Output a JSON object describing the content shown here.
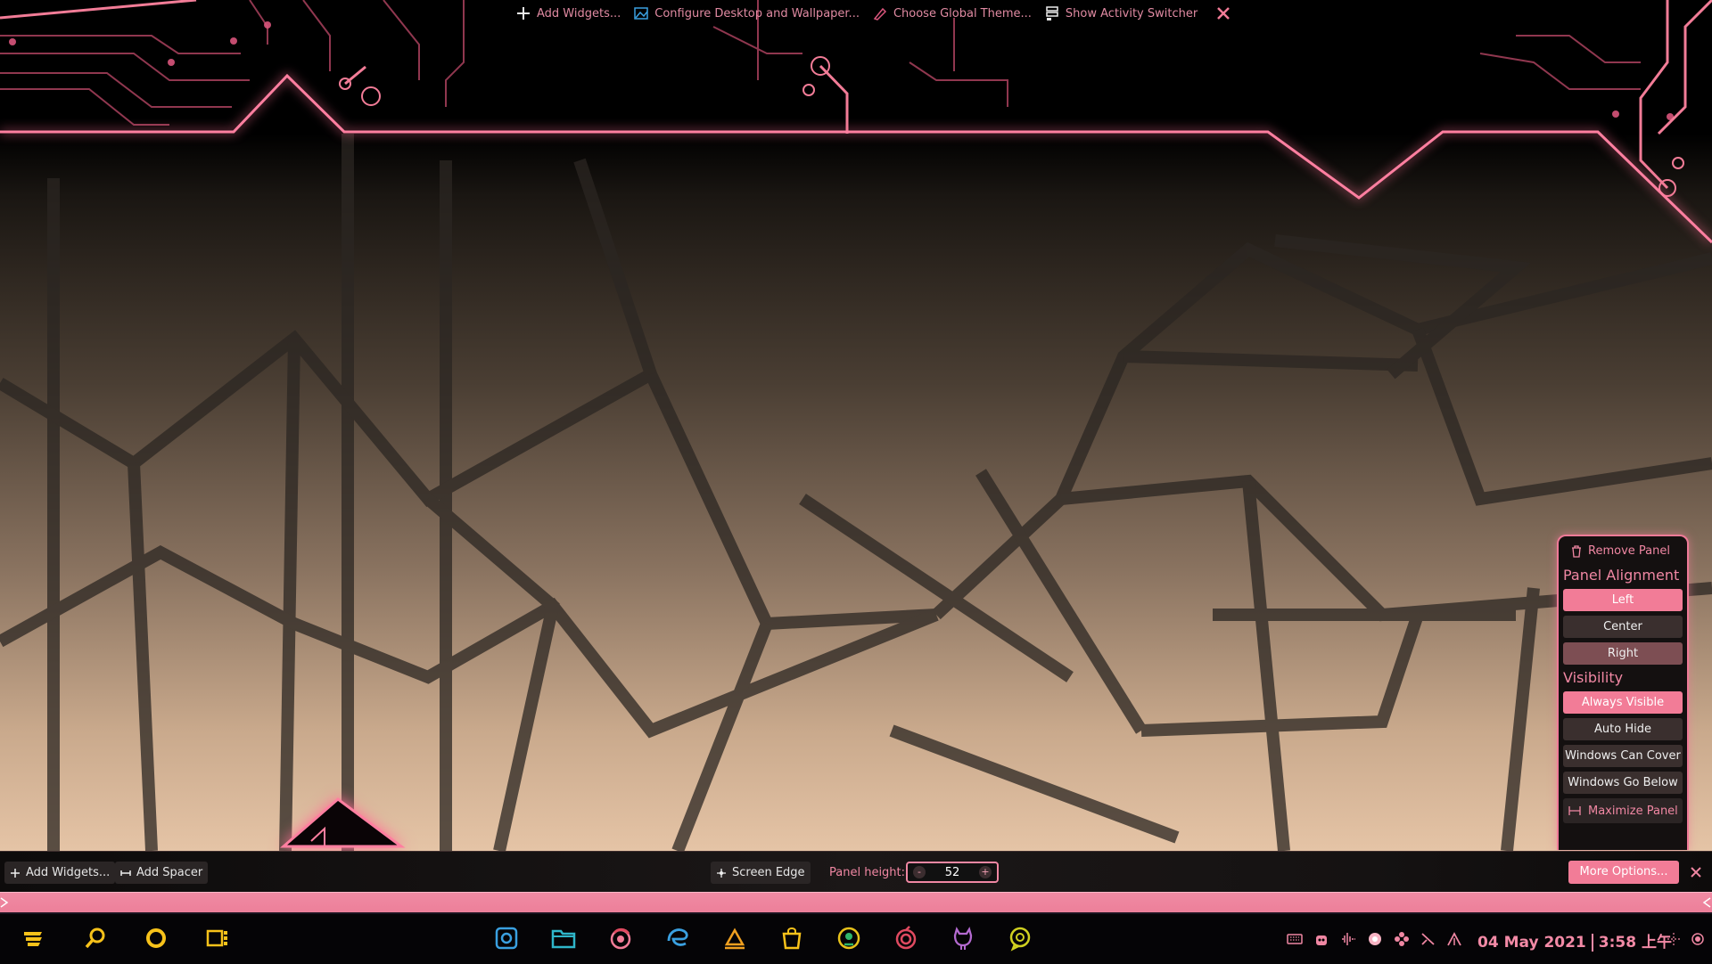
{
  "desktop_toolbox": {
    "add_widgets": "Add Widgets...",
    "configure_desktop": "Configure Desktop and Wallpaper...",
    "global_theme": "Choose Global Theme...",
    "activity_switcher": "Show Activity Switcher"
  },
  "panel_options": {
    "remove_panel": "Remove Panel",
    "alignment_heading": "Panel Alignment",
    "alignment": [
      "Left",
      "Center",
      "Right"
    ],
    "alignment_selected": "Left",
    "visibility_heading": "Visibility",
    "visibility": [
      "Always Visible",
      "Auto Hide",
      "Windows Can Cover",
      "Windows Go Below"
    ],
    "visibility_selected": "Always Visible",
    "maximize_panel": "Maximize Panel"
  },
  "panel_edit_bar": {
    "add_widgets": "Add Widgets...",
    "add_spacer": "Add Spacer",
    "screen_edge": "Screen Edge",
    "panel_height_label": "Panel height:",
    "panel_height_value": "52",
    "more_options": "More Options..."
  },
  "taskbar": {
    "launchers": [
      "launcher-menu-icon",
      "search-icon",
      "circle-app-icon",
      "film-app-icon"
    ],
    "tasks": [
      "screenshot-app-icon",
      "file-manager-icon",
      "firefox-icon",
      "edge-browser-icon",
      "bookmark-app-icon",
      "store-bag-icon",
      "qq-icon",
      "spiral-app-icon",
      "github-icon",
      "chat-bubble-icon"
    ],
    "clock_date": "04 May 2021",
    "clock_time": "3:58 上午"
  },
  "colors": {
    "accent": "#f27c97",
    "accent_text": "#f087a3",
    "panel_bg": "#141010"
  }
}
